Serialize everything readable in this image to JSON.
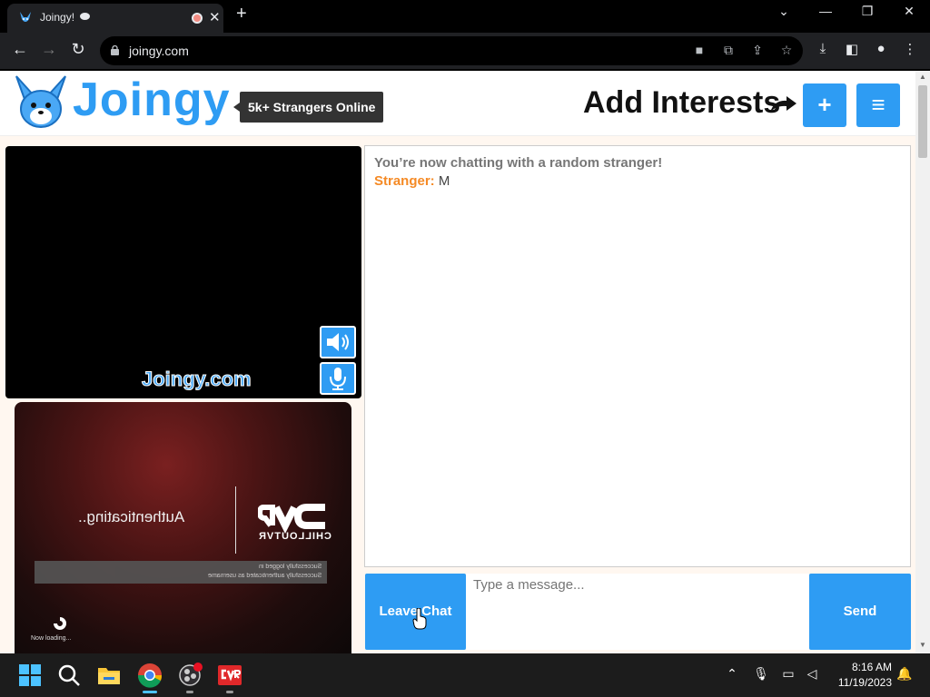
{
  "browser": {
    "tab_title": "Joingy!",
    "new_tab_label": "+",
    "url": "joingy.com"
  },
  "header": {
    "logo_text": "Joingy",
    "online_badge": "5k+ Strangers Online",
    "interests_title": "Add Interests",
    "add_button": "+",
    "menu_button": "≡"
  },
  "video": {
    "watermark": "Joingy.com",
    "remote_overlay": {
      "brand": "CHILLOUTVR",
      "status": "Authenticating..",
      "log_line_1": "Successfully logged in",
      "log_line_2": "Successfully authenticated as username",
      "loading": "Now loading..."
    }
  },
  "chat": {
    "status": "You’re now chatting with a random stranger!",
    "messages": [
      {
        "speaker": "Stranger:",
        "text": " M"
      }
    ],
    "leave_button": "Leave Chat",
    "input_placeholder": "Type a message...",
    "send_button": "Send"
  },
  "taskbar": {
    "time": "8:16 AM",
    "date": "11/19/2023"
  },
  "colors": {
    "accent": "#2e9cf3",
    "stranger_label": "#f58a25"
  }
}
